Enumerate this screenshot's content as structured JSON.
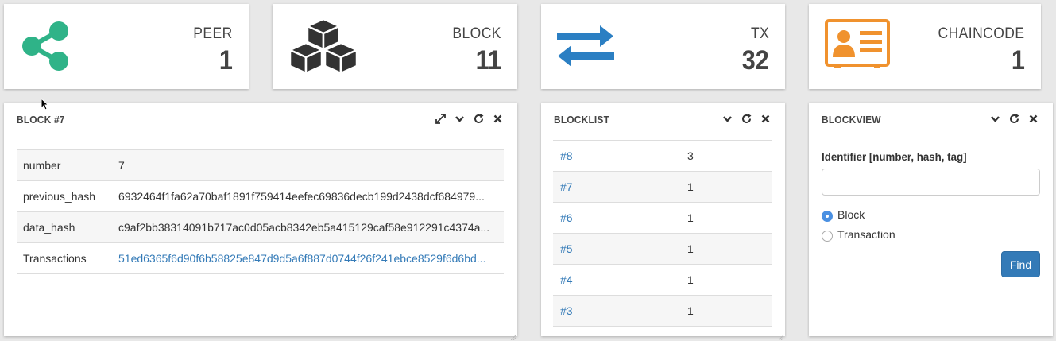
{
  "stats": [
    {
      "label": "PEER",
      "value": "1",
      "icon": "share-icon",
      "color": "#2fb388"
    },
    {
      "label": "BLOCK",
      "value": "11",
      "icon": "cubes-icon",
      "color": "#333333"
    },
    {
      "label": "TX",
      "value": "32",
      "icon": "exchange-arrows-icon",
      "color": "#2b7fc3"
    },
    {
      "label": "CHAINCODE",
      "value": "1",
      "icon": "id-card-icon",
      "color": "#f0922e"
    }
  ],
  "block_panel": {
    "title": "BLOCK #7",
    "rows": [
      {
        "key": "number",
        "value": "7"
      },
      {
        "key": "previous_hash",
        "value": "6932464f1fa62a70baf1891f759414eefec69836decb199d2438dcf684979..."
      },
      {
        "key": "data_hash",
        "value": "c9af2bb38314091b717ac0d05acb8342eb5a415129caf58e912291c4374a..."
      },
      {
        "key": "Transactions",
        "value": "51ed6365f6d90f6b58825e847d9d5a6f887d0744f26f241ebce8529f6d6bd..."
      }
    ]
  },
  "blocklist_panel": {
    "title": "BLOCKLIST",
    "rows": [
      {
        "num": "#8",
        "count": "3"
      },
      {
        "num": "#7",
        "count": "1"
      },
      {
        "num": "#6",
        "count": "1"
      },
      {
        "num": "#5",
        "count": "1"
      },
      {
        "num": "#4",
        "count": "1"
      },
      {
        "num": "#3",
        "count": "1"
      }
    ]
  },
  "blockview_panel": {
    "title": "BLOCKVIEW",
    "identifier_label": "Identifier [number, hash, tag]",
    "identifier_value": "",
    "options": [
      "Block",
      "Transaction"
    ],
    "selected_option": "Block",
    "find_label": "Find"
  },
  "colors": {
    "link": "#337ab7",
    "primary_button": "#337ab7",
    "radio_selected": "#4a90e2"
  }
}
